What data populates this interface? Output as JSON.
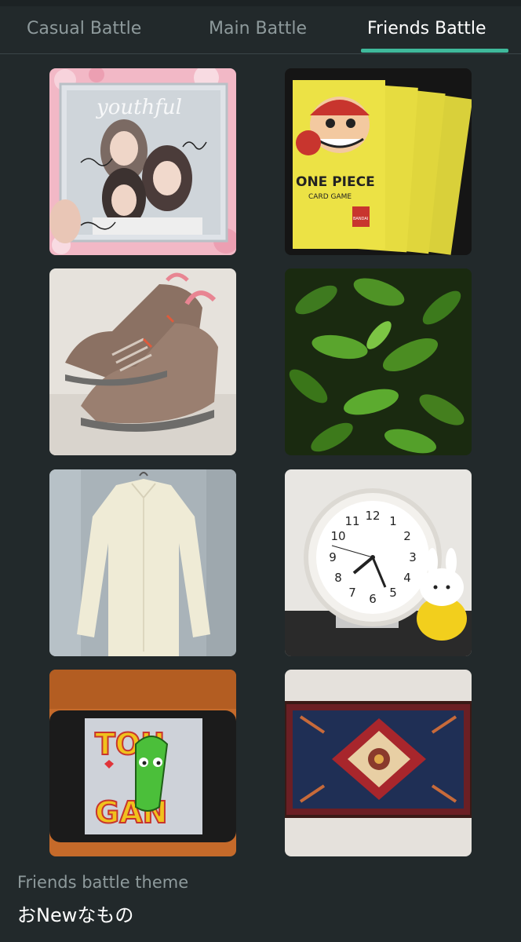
{
  "tabs": [
    {
      "label": "Casual Battle",
      "active": false
    },
    {
      "label": "Main Battle",
      "active": false
    },
    {
      "label": "Friends Battle",
      "active": true
    }
  ],
  "accent_color": "#3fb99b",
  "items": [
    {
      "name": "cd-album-photo",
      "caption": "youthful"
    },
    {
      "name": "card-packs-photo",
      "caption": "ONE PIECE",
      "subcaption": "CARD GAME",
      "brand": "BANDAI"
    },
    {
      "name": "sneakers-photo"
    },
    {
      "name": "plant-leaves-photo"
    },
    {
      "name": "shirt-photo"
    },
    {
      "name": "clock-photo",
      "clock_numbers": [
        "12",
        "1",
        "2",
        "3",
        "4",
        "5",
        "6",
        "7",
        "8",
        "9",
        "10",
        "11"
      ]
    },
    {
      "name": "tablet-photo",
      "caption_top": "TOU",
      "caption_bottom": "GAN"
    },
    {
      "name": "rug-photo"
    }
  ],
  "theme": {
    "label": "Friends battle theme",
    "value": "おNewなもの"
  }
}
